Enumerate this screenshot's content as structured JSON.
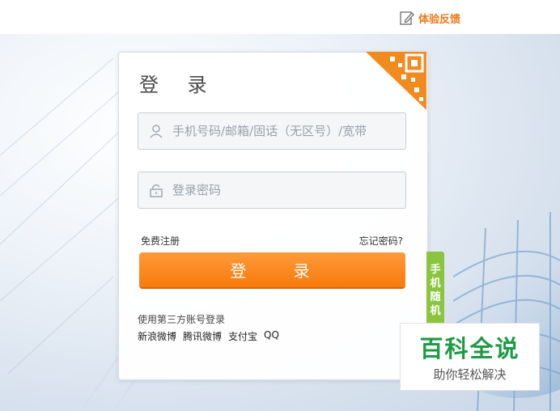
{
  "topbar": {
    "feedback_label": "体验反馈",
    "feedback_icon": "edit-icon"
  },
  "login": {
    "title": "登 录",
    "qr_corner_icon": "qr-code-icon",
    "account_field": {
      "placeholder": "手机号码/邮箱/固话（无区号）/宽带",
      "icon": "user-icon"
    },
    "password_field": {
      "placeholder": "登录密码",
      "icon": "lock-icon"
    },
    "register_link": "免费注册",
    "forgot_link": "忘记密码?",
    "submit_label": "登 录",
    "third_party_title": "使用第三方账号登录",
    "third_party_links": [
      "新浪微博",
      "腾讯微博",
      "支付宝",
      "QQ"
    ]
  },
  "side_tab": {
    "chars": [
      "手",
      "机",
      "随",
      "机"
    ]
  },
  "watermark": {
    "logo": "百科全说",
    "tagline": "助你轻松解决"
  },
  "colors": {
    "accent": "#f77a0c",
    "tab_green": "#8bc53f",
    "watermark_green": "#1c9b45"
  }
}
